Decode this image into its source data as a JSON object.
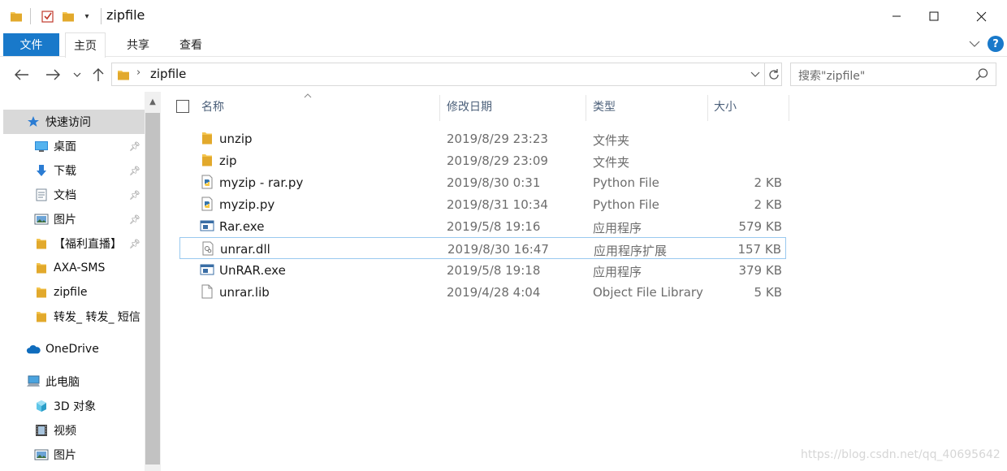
{
  "window": {
    "title": "zipfile",
    "controls": {
      "minimize_icon": "minimize-icon",
      "maximize_icon": "maximize-icon",
      "close_icon": "close-icon"
    }
  },
  "ribbon": {
    "tabs": [
      {
        "label": "文件",
        "active": false
      },
      {
        "label": "主页",
        "active": true
      },
      {
        "label": "共享",
        "active": false
      },
      {
        "label": "查看",
        "active": false
      }
    ],
    "help_label": "?"
  },
  "navigation": {
    "path_segment": "zipfile",
    "search_placeholder": "搜索\"zipfile\""
  },
  "sidebar": {
    "items": [
      {
        "label": "快速访问",
        "icon": "star-icon",
        "pinned": false,
        "selected": true
      },
      {
        "label": "桌面",
        "icon": "desktop-icon",
        "pinned": true
      },
      {
        "label": "下载",
        "icon": "download-icon",
        "pinned": true
      },
      {
        "label": "文档",
        "icon": "document-icon",
        "pinned": true
      },
      {
        "label": "图片",
        "icon": "picture-icon",
        "pinned": true
      },
      {
        "label": "【福利直播】",
        "icon": "folder-icon",
        "pinned": true
      },
      {
        "label": "AXA-SMS",
        "icon": "folder-icon",
        "pinned": false
      },
      {
        "label": "zipfile",
        "icon": "folder-icon",
        "pinned": false
      },
      {
        "label": "转发_ 转发_ 短信",
        "icon": "folder-icon",
        "pinned": false
      },
      {
        "label": "OneDrive",
        "icon": "cloud-icon",
        "pinned": false
      },
      {
        "label": "此电脑",
        "icon": "computer-icon",
        "pinned": false
      },
      {
        "label": "3D 对象",
        "icon": "cube-icon",
        "pinned": false
      },
      {
        "label": "视频",
        "icon": "video-icon",
        "pinned": false
      },
      {
        "label": "图片",
        "icon": "picture-icon",
        "pinned": false
      }
    ]
  },
  "filelist": {
    "columns": {
      "name": "名称",
      "date": "修改日期",
      "type": "类型",
      "size": "大小"
    },
    "files": [
      {
        "name": "unzip",
        "date": "2019/8/29 23:23",
        "type": "文件夹",
        "size": "",
        "icon": "folder-icon"
      },
      {
        "name": "zip",
        "date": "2019/8/29 23:09",
        "type": "文件夹",
        "size": "",
        "icon": "folder-icon"
      },
      {
        "name": "myzip - rar.py",
        "date": "2019/8/30 0:31",
        "type": "Python File",
        "size": "2 KB",
        "icon": "python-file-icon"
      },
      {
        "name": "myzip.py",
        "date": "2019/8/31 10:34",
        "type": "Python File",
        "size": "2 KB",
        "icon": "python-file-icon"
      },
      {
        "name": "Rar.exe",
        "date": "2019/5/8 19:16",
        "type": "应用程序",
        "size": "579 KB",
        "icon": "exe-icon"
      },
      {
        "name": "unrar.dll",
        "date": "2019/8/30 16:47",
        "type": "应用程序扩展",
        "size": "157 KB",
        "icon": "dll-icon"
      },
      {
        "name": "UnRAR.exe",
        "date": "2019/5/8 19:18",
        "type": "应用程序",
        "size": "379 KB",
        "icon": "exe-icon"
      },
      {
        "name": "unrar.lib",
        "date": "2019/4/28 4:04",
        "type": "Object File Library",
        "size": "5 KB",
        "icon": "file-icon"
      }
    ]
  },
  "watermark": "https://blog.csdn.net/qq_40695642",
  "colors": {
    "accent": "#1979ca",
    "folder": "#f4c54f",
    "selected": "#d9d9d9",
    "focus_border": "#99c9ef"
  }
}
